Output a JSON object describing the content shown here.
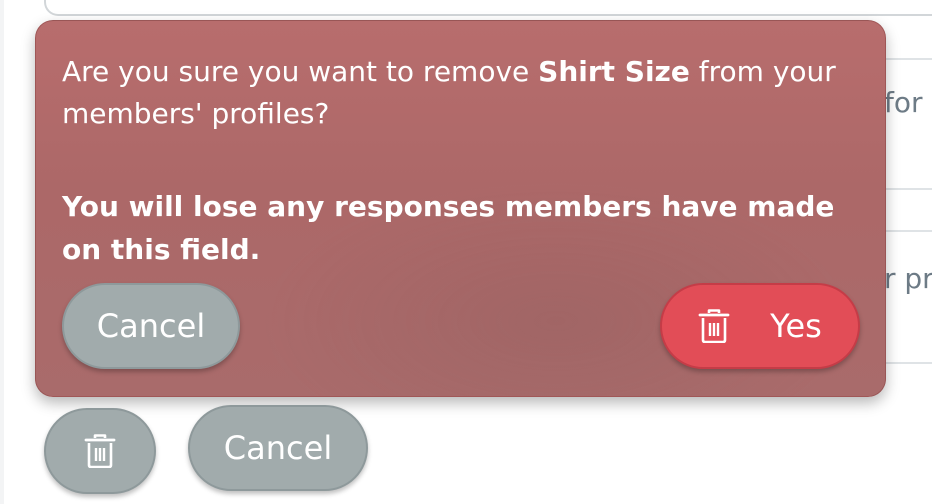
{
  "background": {
    "partial_text_1": "for y",
    "partial_text_2": "r pr"
  },
  "popover": {
    "message_prefix": "Are you sure you want to remove ",
    "field_name": "Shirt Size",
    "message_suffix": " from your members' profiles?",
    "warning": "You will lose any responses members have made on this field.",
    "cancel_label": "Cancel",
    "confirm_label": "Yes",
    "confirm_icon": "trash-icon"
  },
  "actions": {
    "delete_icon": "trash-icon",
    "cancel_label": "Cancel"
  },
  "colors": {
    "popover_bg": "#b06a6a",
    "danger": "#e24d57",
    "neutral_button": "#a1abac"
  }
}
